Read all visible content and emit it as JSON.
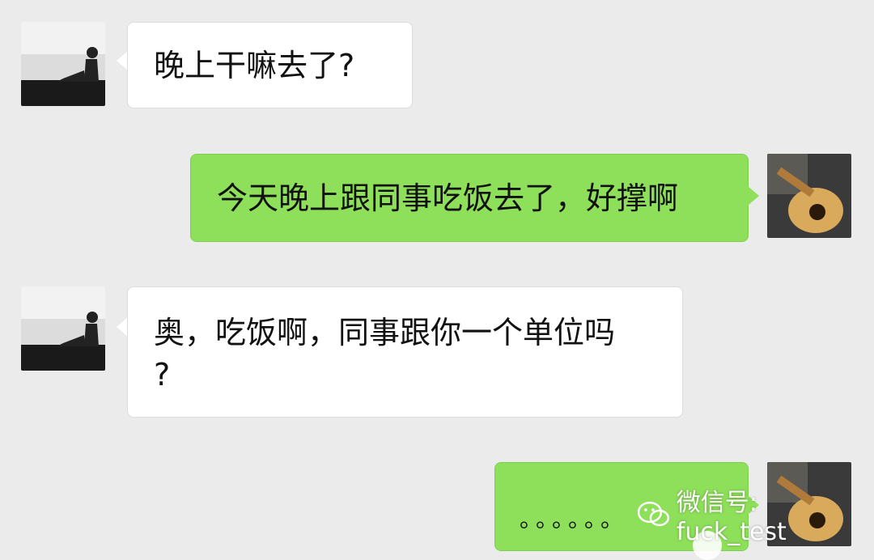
{
  "colors": {
    "background": "#ebebeb",
    "incoming_bubble": "#ffffff",
    "outgoing_bubble": "#8ee05a"
  },
  "messages": [
    {
      "side": "left",
      "text": "晚上干嘛去了?"
    },
    {
      "side": "right",
      "text": "今天晚上跟同事吃饭去了，好撑啊"
    },
    {
      "side": "left",
      "line1": "奥，吃饭啊，同事跟你一个单位吗",
      "line2": "?"
    },
    {
      "side": "right",
      "text": "。。。。。。"
    }
  ],
  "watermark": {
    "icon": "wechat-icon",
    "text": "微信号: fuck_test"
  }
}
